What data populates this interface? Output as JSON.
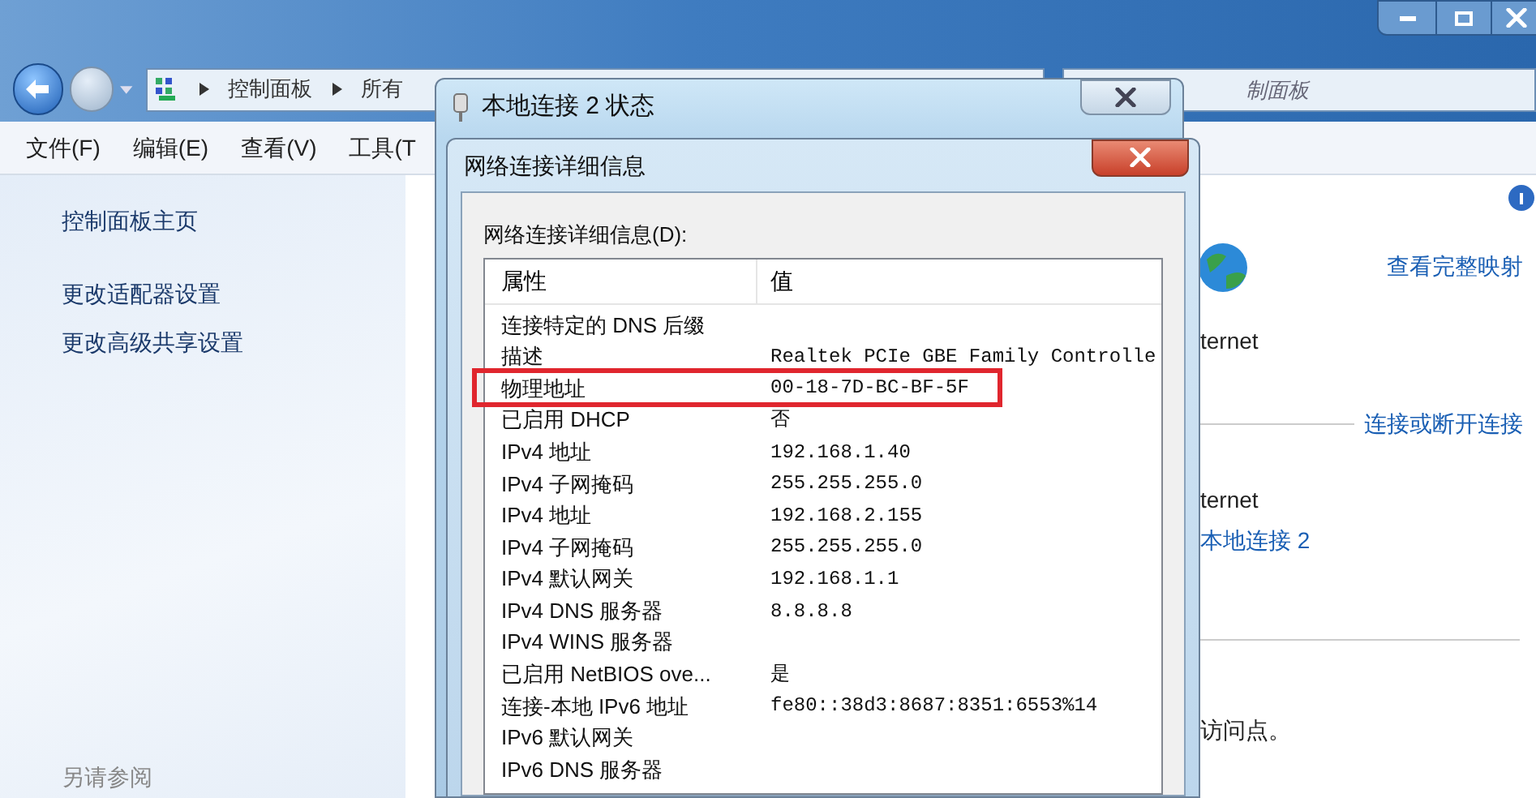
{
  "address_bar": {
    "breadcrumb": [
      "控制面板",
      "所有"
    ]
  },
  "search": {
    "placeholder": "制面板"
  },
  "menu": [
    "文件(F)",
    "编辑(E)",
    "查看(V)",
    "工具(T"
  ],
  "sidebar": {
    "links": [
      "控制面板主页",
      "更改适配器设置",
      "更改高级共享设置"
    ],
    "see_also": "另请参阅"
  },
  "main": {
    "map_link": "查看完整映射",
    "internet_label": "ternet",
    "connect_link": "连接或断开连接",
    "network_label": "ternet",
    "connection_link": "本地连接 2",
    "footer_text": "访问点。"
  },
  "status_dialog": {
    "title": "本地连接 2 状态"
  },
  "details_dialog": {
    "title": "网络连接详细信息",
    "list_label": "网络连接详细信息(D):",
    "columns": [
      "属性",
      "值"
    ],
    "rows": [
      {
        "property": "连接特定的 DNS 后缀",
        "highlighted": false
      },
      {
        "property": "描述",
        "value": "Realtek PCIe GBE Family Controlle",
        "highlighted": false
      },
      {
        "property": "物理地址",
        "value": "00-18-7D-BC-BF-5F",
        "highlighted": true
      },
      {
        "property": "已启用 DHCP",
        "value": "否",
        "highlighted": false
      },
      {
        "property": "IPv4 地址",
        "value": "192.168.1.40",
        "highlighted": false
      },
      {
        "property": "IPv4 子网掩码",
        "value": "255.255.255.0",
        "highlighted": false
      },
      {
        "property": "IPv4 地址",
        "value": "192.168.2.155",
        "highlighted": false
      },
      {
        "property": "IPv4 子网掩码",
        "value": "255.255.255.0",
        "highlighted": false
      },
      {
        "property": "IPv4 默认网关",
        "value": "192.168.1.1",
        "highlighted": false
      },
      {
        "property": "IPv4 DNS 服务器",
        "value": "8.8.8.8",
        "highlighted": false
      },
      {
        "property": "IPv4 WINS 服务器",
        "highlighted": false
      },
      {
        "property": "已启用 NetBIOS ove...",
        "value": "是",
        "highlighted": false
      },
      {
        "property": "连接-本地 IPv6 地址",
        "value": "fe80::38d3:8687:8351:6553%14",
        "highlighted": false
      },
      {
        "property": "IPv6 默认网关",
        "highlighted": false
      },
      {
        "property": "IPv6 DNS 服务器",
        "highlighted": false
      }
    ]
  }
}
